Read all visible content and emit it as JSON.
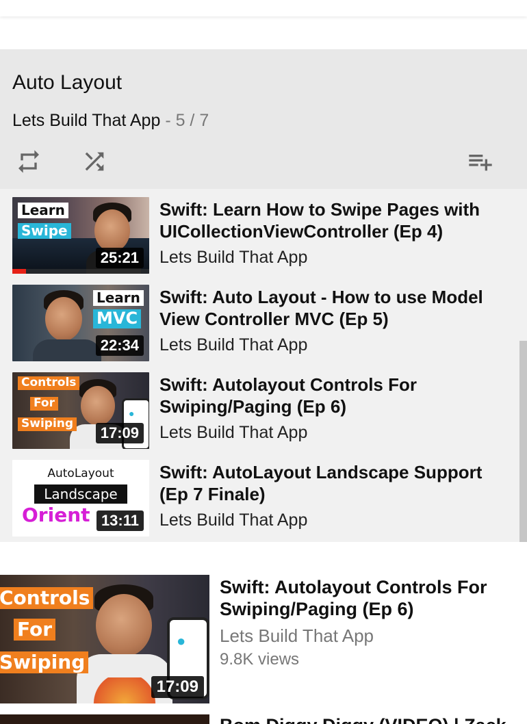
{
  "playlist": {
    "title": "Auto Layout",
    "channel": "Lets Build That App",
    "position": "- 5 / 7",
    "controls": {
      "loop_icon": "loop-icon",
      "shuffle_icon": "shuffle-icon",
      "save_icon": "playlist-add-icon"
    },
    "items": [
      {
        "title": "Swift: Learn How to Swipe Pages with UICollectionViewController (Ep 4)",
        "channel": "Lets Build That App",
        "duration": "25:21",
        "thumb_text": [
          "Learn",
          "Swipe"
        ],
        "watched_fraction": 0.1
      },
      {
        "title": "Swift: Auto Layout - How to use Model View Controller MVC (Ep 5)",
        "channel": "Lets Build That App",
        "duration": "22:34",
        "thumb_text": [
          "Learn",
          "MVC"
        ]
      },
      {
        "title": "Swift: Autolayout Controls For Swiping/Paging (Ep 6)",
        "channel": "Lets Build That App",
        "duration": "17:09",
        "thumb_text": [
          "Controls",
          "For",
          "Swiping"
        ]
      },
      {
        "title": "Swift: AutoLayout Landscape Support (Ep 7 Finale)",
        "channel": "Lets Build That App",
        "duration": "13:11",
        "thumb_text": [
          "AutoLayout",
          "Landscape",
          "Orient"
        ]
      }
    ]
  },
  "recommended": [
    {
      "title": "Swift: Autolayout Controls For Swiping/Paging (Ep 6)",
      "channel": "Lets Build That App",
      "views": "9.8K views",
      "duration": "17:09",
      "thumb_text": [
        "Controls",
        "For",
        "Swiping"
      ]
    },
    {
      "title": "Bom Diggy Diggy (VIDEO) | Zack"
    }
  ],
  "colors": {
    "header_bg": "#e8e8e8",
    "list_bg": "#f1f1f1",
    "progress_red": "#e62117",
    "orange_label": "#f07f1e",
    "teal_label": "#29b6d8",
    "magenta_text": "#d61fd6"
  }
}
